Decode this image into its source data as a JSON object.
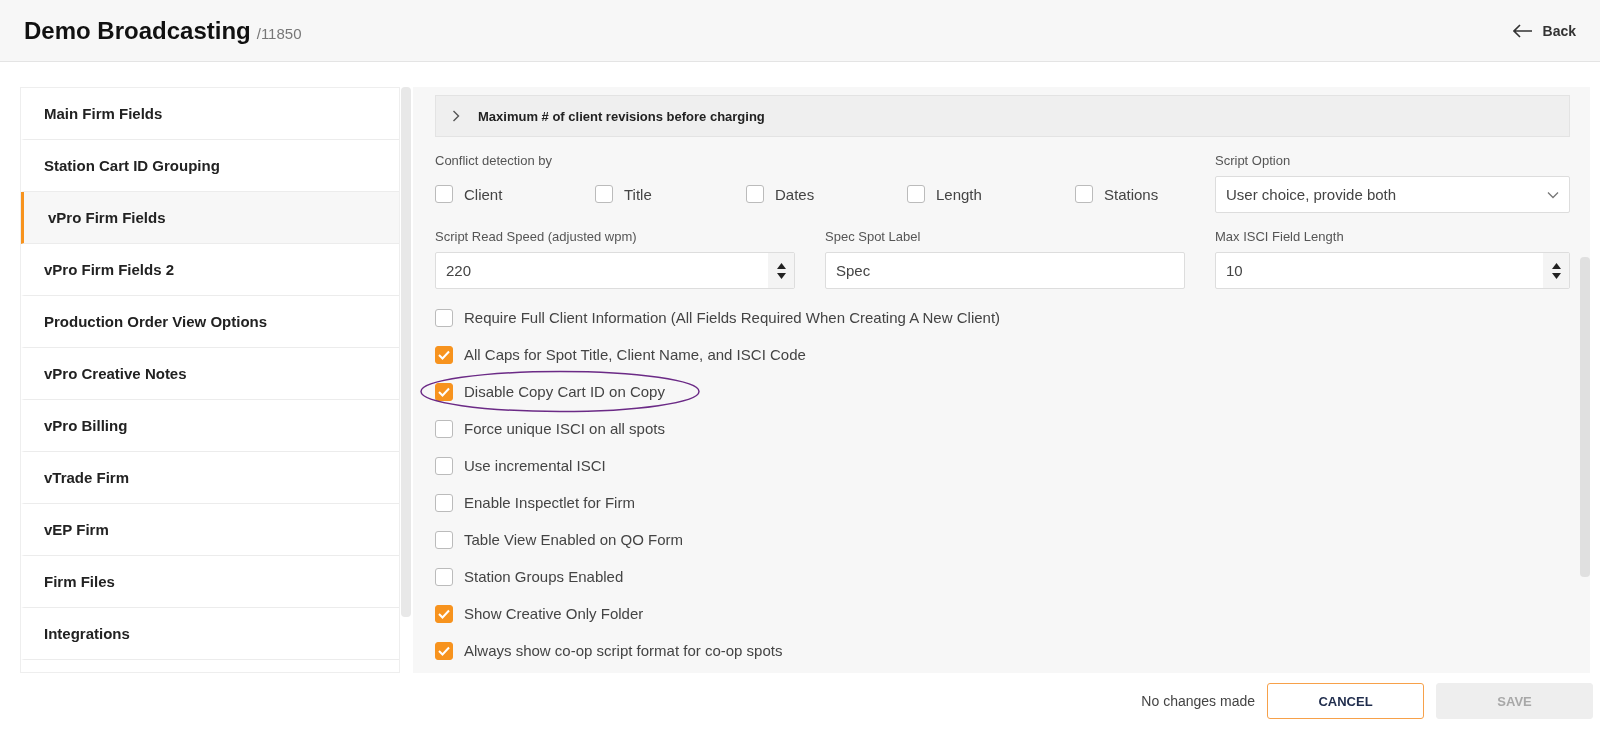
{
  "header": {
    "title": "Demo Broadcasting",
    "id": "/11850",
    "back": "Back"
  },
  "sidebar": {
    "items": [
      {
        "label": "Main Firm Fields",
        "selected": false
      },
      {
        "label": "Station Cart ID Grouping",
        "selected": false
      },
      {
        "label": "vPro Firm Fields",
        "selected": true
      },
      {
        "label": "vPro Firm Fields 2",
        "selected": false
      },
      {
        "label": "Production Order View Options",
        "selected": false
      },
      {
        "label": "vPro Creative Notes",
        "selected": false
      },
      {
        "label": "vPro Billing",
        "selected": false
      },
      {
        "label": "vTrade Firm",
        "selected": false
      },
      {
        "label": "vEP Firm",
        "selected": false
      },
      {
        "label": "Firm Files",
        "selected": false
      },
      {
        "label": "Integrations",
        "selected": false
      }
    ]
  },
  "accordion": {
    "label": "Maximum # of client revisions before charging",
    "expanded": false
  },
  "conflict_detection": {
    "label": "Conflict detection by",
    "options": [
      {
        "label": "Client",
        "checked": false
      },
      {
        "label": "Title",
        "checked": false
      },
      {
        "label": "Dates",
        "checked": false
      },
      {
        "label": "Length",
        "checked": false
      },
      {
        "label": "Stations",
        "checked": false
      }
    ]
  },
  "script_option": {
    "label": "Script Option",
    "value": "User choice, provide both"
  },
  "fields": [
    {
      "label": "Script Read Speed (adjusted wpm)",
      "value": "220",
      "kind": "number"
    },
    {
      "label": "Spec Spot Label",
      "value": "Spec",
      "kind": "text"
    },
    {
      "label": "Max ISCI Field Length",
      "value": "10",
      "kind": "number"
    }
  ],
  "options": [
    {
      "label": "Require Full Client Information (All Fields Required When Creating A New Client)",
      "checked": false,
      "highlighted": false
    },
    {
      "label": "All Caps for Spot Title, Client Name, and ISCI Code",
      "checked": true,
      "highlighted": false
    },
    {
      "label": "Disable Copy Cart ID on Copy",
      "checked": true,
      "highlighted": true
    },
    {
      "label": "Force unique ISCI on all spots",
      "checked": false,
      "highlighted": false
    },
    {
      "label": "Use incremental ISCI",
      "checked": false,
      "highlighted": false
    },
    {
      "label": "Enable Inspectlet for Firm",
      "checked": false,
      "highlighted": false
    },
    {
      "label": "Table View Enabled on QO Form",
      "checked": false,
      "highlighted": false
    },
    {
      "label": "Station Groups Enabled",
      "checked": false,
      "highlighted": false
    },
    {
      "label": "Show Creative Only Folder",
      "checked": true,
      "highlighted": false
    },
    {
      "label": "Always show co-op script format for co-op spots",
      "checked": true,
      "highlighted": false
    }
  ],
  "footer": {
    "status": "No changes made",
    "cancel": "CANCEL",
    "save": "SAVE",
    "save_disabled": true
  }
}
